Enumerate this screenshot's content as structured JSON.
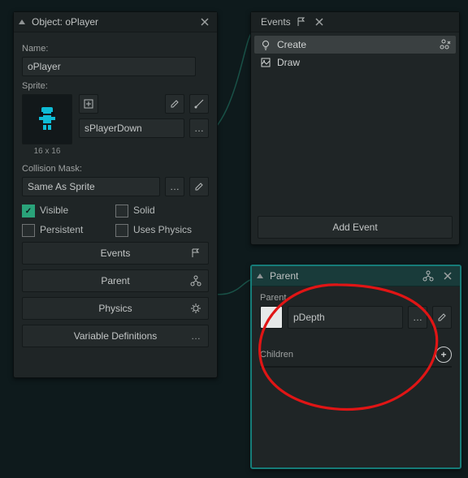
{
  "object_panel": {
    "title": "Object: oPlayer",
    "name_label": "Name:",
    "name_value": "oPlayer",
    "sprite_label": "Sprite:",
    "sprite_name": "sPlayerDown",
    "sprite_size": "16 x 16",
    "collision_label": "Collision Mask:",
    "collision_value": "Same As Sprite",
    "chk_visible": "Visible",
    "chk_solid": "Solid",
    "chk_persistent": "Persistent",
    "chk_physics": "Uses Physics",
    "btn_events": "Events",
    "btn_parent": "Parent",
    "btn_physics": "Physics",
    "btn_vars": "Variable Definitions",
    "ellipsis": "…"
  },
  "events_panel": {
    "title": "Events",
    "items": [
      {
        "label": "Create",
        "selected": true
      },
      {
        "label": "Draw",
        "selected": false
      }
    ],
    "add_label": "Add Event"
  },
  "parent_panel": {
    "title": "Parent",
    "parent_label": "Parent",
    "parent_value": "pDepth",
    "children_label": "Children",
    "ellipsis": "…"
  }
}
